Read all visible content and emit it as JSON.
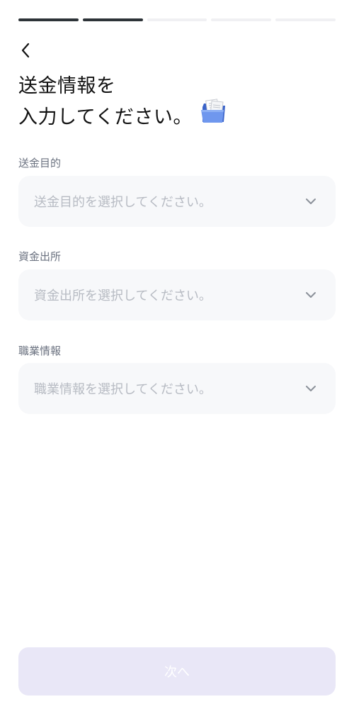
{
  "progress": {
    "steps_total": 5,
    "steps_completed": 2
  },
  "title": {
    "line1": "送金情報を",
    "line2": "入力してください。"
  },
  "icons": {
    "back": "chevron-left-icon",
    "title_emoji": "folder-with-documents-icon",
    "dropdown": "chevron-down-icon"
  },
  "fields": [
    {
      "label": "送金目的",
      "placeholder": "送金目的を選択してください。"
    },
    {
      "label": "資金出所",
      "placeholder": "資金出所を選択してください。"
    },
    {
      "label": "職業情報",
      "placeholder": "職業情報を選択してください。"
    }
  ],
  "next_button": {
    "label": "次へ"
  },
  "colors": {
    "progress_active": "#2d3338",
    "progress_inactive": "#f0f0f3",
    "field_background": "#f7f8fa",
    "placeholder_text": "#b7bbc3",
    "label_text": "#6b7280",
    "button_disabled_bg": "#e9e7f7"
  }
}
